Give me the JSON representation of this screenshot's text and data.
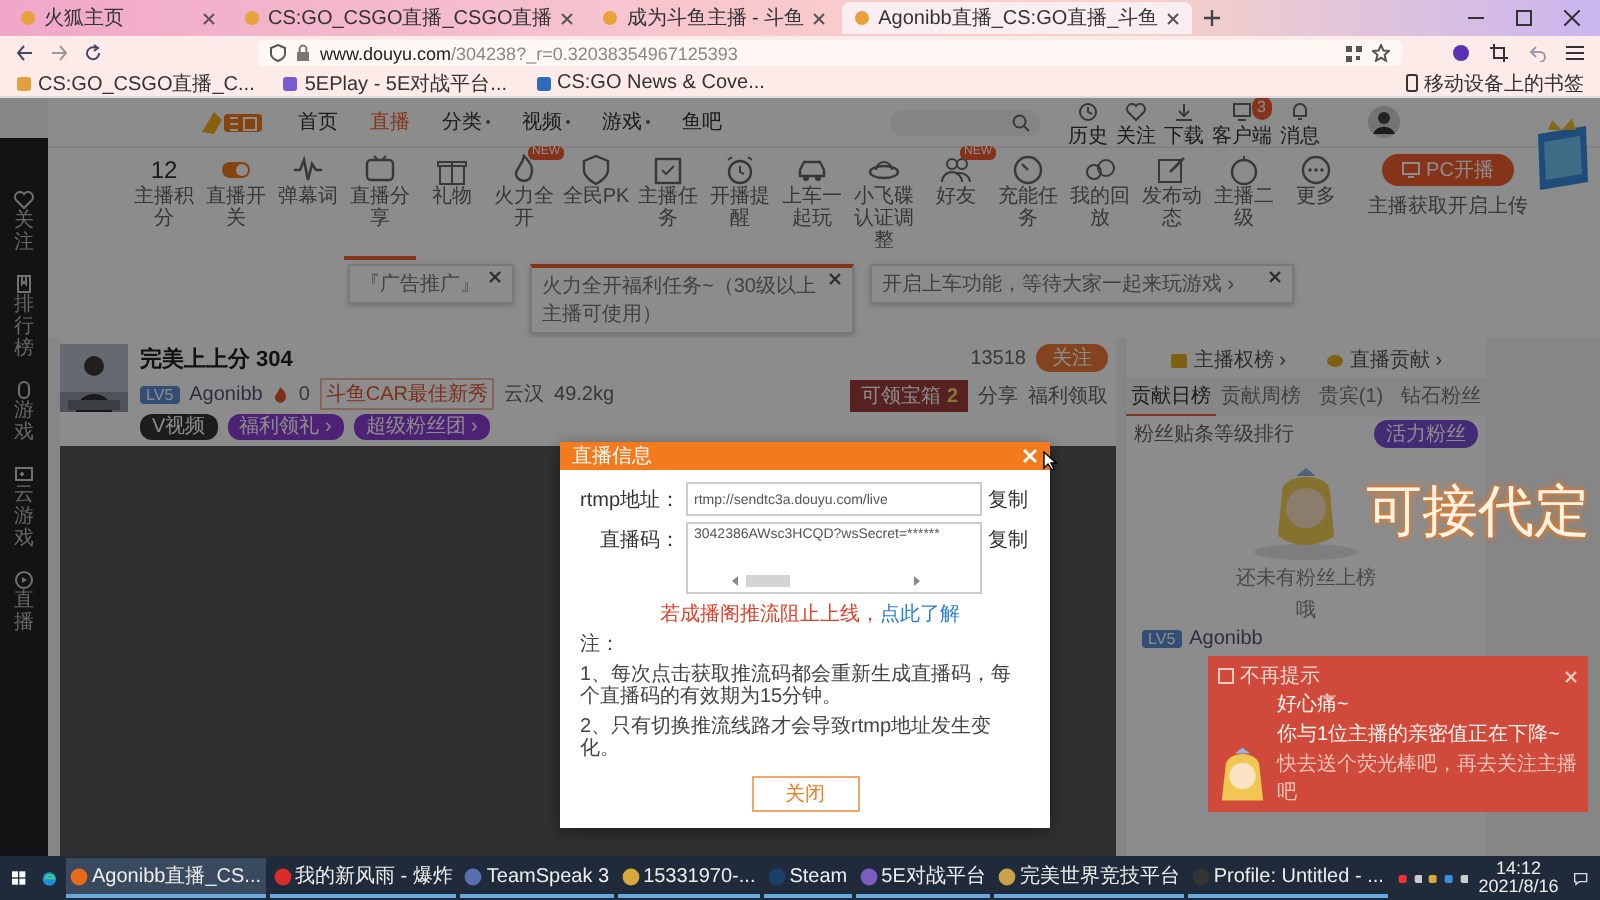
{
  "browser": {
    "tabs": [
      {
        "title": "火狐主页",
        "selected": false
      },
      {
        "title": "CS:GO_CSGO直播_CSGO直播",
        "selected": false
      },
      {
        "title": "成为斗鱼主播 - 斗鱼",
        "selected": false
      },
      {
        "title": "Agonibb直播_CS:GO直播_斗鱼",
        "selected": true
      }
    ],
    "url_host": "www.douyu.com",
    "url_path": "/304238?_r=0.32038354967125393",
    "bookmarks": [
      "CS:GO_CSGO直播_C...",
      "5EPlay - 5E对战平台...",
      "CS:GO News & Cove..."
    ],
    "mobile_bookmarks": "移动设备上的书签"
  },
  "sidebar": {
    "items": [
      "关注",
      "排行榜",
      "游戏",
      "云游戏",
      "直播"
    ]
  },
  "nav": [
    {
      "label": "首页",
      "selected": false,
      "dropdown": false
    },
    {
      "label": "直播",
      "selected": true,
      "dropdown": false
    },
    {
      "label": "分类",
      "selected": false,
      "dropdown": true
    },
    {
      "label": "视频",
      "selected": false,
      "dropdown": true
    },
    {
      "label": "游戏",
      "selected": false,
      "dropdown": true
    },
    {
      "label": "鱼吧",
      "selected": false,
      "dropdown": false
    }
  ],
  "header_links": [
    {
      "label": "历史"
    },
    {
      "label": "关注"
    },
    {
      "label": "下载"
    },
    {
      "label": "客户端",
      "badge": "3"
    },
    {
      "label": "消息"
    }
  ],
  "features": [
    {
      "kind": "number",
      "value": "12",
      "label": "主播积分",
      "selected": false
    },
    {
      "kind": "icon",
      "label": "直播开关",
      "selected": false
    },
    {
      "kind": "icon",
      "label": "弹幕词",
      "selected": false
    },
    {
      "kind": "icon",
      "label": "直播分享",
      "selected": true
    },
    {
      "kind": "icon",
      "label": "礼物",
      "selected": false
    },
    {
      "kind": "icon",
      "label": "火力全开",
      "badge": "NEW",
      "selected": false
    },
    {
      "kind": "icon",
      "label": "全民PK",
      "selected": false
    },
    {
      "kind": "icon",
      "label": "主播任务",
      "selected": false
    },
    {
      "kind": "icon",
      "label": "开播提醒",
      "selected": false
    },
    {
      "kind": "icon",
      "label": "上车一起玩",
      "selected": false
    },
    {
      "kind": "icon",
      "label": "小飞碟认证调整",
      "selected": false
    },
    {
      "kind": "icon",
      "label": "好友",
      "badge": "NEW",
      "selected": false
    },
    {
      "kind": "icon",
      "label": "充能任务",
      "selected": false
    },
    {
      "kind": "icon",
      "label": "我的回放",
      "selected": false
    },
    {
      "kind": "icon",
      "label": "发布动态",
      "selected": false
    },
    {
      "kind": "icon",
      "label": "主播二级",
      "selected": false
    },
    {
      "kind": "icon",
      "label": "更多",
      "selected": false
    }
  ],
  "pc_live": {
    "button": "PC开播",
    "caption": "主播获取开启上传"
  },
  "popups": [
    "『广告推广』",
    "火力全开福利任务~（30级以上主播可使用）",
    "开启上车功能，等待大家一起来玩游戏 ›"
  ],
  "streamer": {
    "title": "完美上上分 304",
    "level": "LV5",
    "name": "Agonibb",
    "hot": "0",
    "tag": "斗鱼CAR最佳新秀",
    "location": "云汉",
    "weight": "49.2kg",
    "buttons": [
      "V视频",
      "福利领礼 ›",
      "超级粉丝团 ›"
    ],
    "followers": "13518",
    "follow": "关注",
    "chest": "可领宝箱",
    "chest_count": "2",
    "share": "分享",
    "welfare": "福利领取"
  },
  "ranking": {
    "links": [
      "主播权榜 ›",
      "直播贡献 ›"
    ],
    "tabs": [
      {
        "label": "贡献日榜",
        "selected": true
      },
      {
        "label": "贡献周榜",
        "selected": false
      },
      {
        "label": "贵宾(1)",
        "selected": false
      },
      {
        "label": "钻石粉丝",
        "selected": false
      }
    ],
    "fan_rank": "粉丝贴条等级排行",
    "fan_button": "活力粉丝",
    "empty": "还未有粉丝上榜",
    "empty_sub": "哦",
    "user_level": "LV5",
    "user_name": "Agonibb"
  },
  "modal": {
    "title": "直播信息",
    "rows": [
      {
        "label": "rtmp地址：",
        "value": "rtmp://sendtc3a.douyu.com/live",
        "action": "复制",
        "multiline": false
      },
      {
        "label": "直播码：",
        "value": "3042386AWsc3HCQD?wsSecret=******",
        "action": "复制",
        "multiline": true
      }
    ],
    "warning": "若成播阁推流阻止上线，",
    "warning_link": "点此了解",
    "notes": [
      "注：",
      "1、每次点击获取推流码都会重新生成直播码，每个直播码的有效期为15分钟。",
      "2、只有切换推流线路才会导致rtmp地址发生变化。"
    ],
    "button": "关闭"
  },
  "notice": {
    "checkbox_label": "不再提示",
    "checked": false,
    "title": "好心痛~",
    "message": "你与1位主播的亲密值正在下降~",
    "hint": "快去送个荧光棒吧，再去关注主播吧"
  },
  "overlay_text": "可接代定",
  "taskbar": {
    "items": [
      {
        "label": "Agonibb直播_CS...",
        "active": true
      },
      {
        "label": "我的新风雨 - 爆炸",
        "active": false
      },
      {
        "label": "TeamSpeak 3",
        "active": false
      },
      {
        "label": "15331970-...",
        "active": false
      },
      {
        "label": "Steam",
        "active": false
      },
      {
        "label": "5E对战平台",
        "active": false
      },
      {
        "label": "完美世界竞技平台",
        "active": false
      },
      {
        "label": "Profile: Untitled - ...",
        "active": false
      }
    ],
    "time": "14:12",
    "date": "2021/8/16"
  }
}
